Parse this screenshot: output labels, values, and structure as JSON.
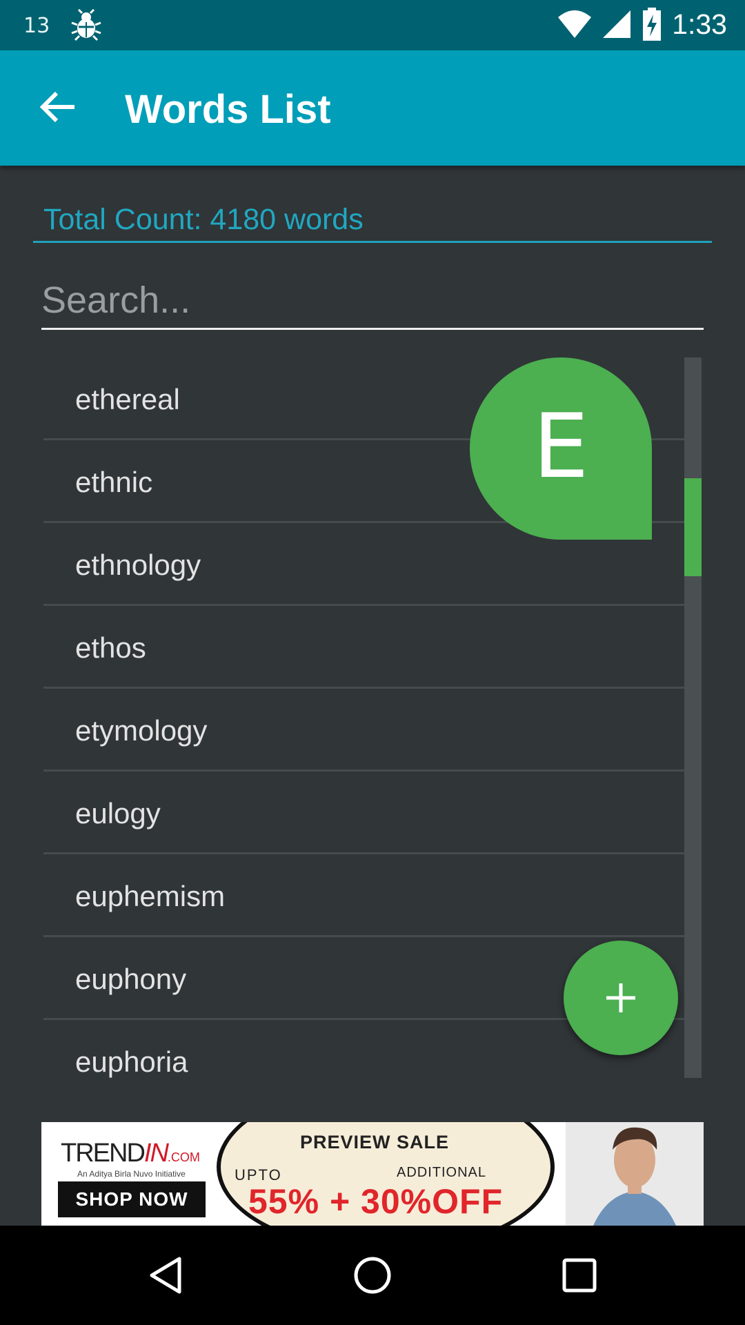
{
  "status_bar": {
    "notification_count": "13",
    "time": "1:33",
    "icons": [
      "bug-icon",
      "wifi-icon",
      "signal-icon",
      "battery-charging-icon"
    ]
  },
  "app_bar": {
    "title": "Words List",
    "back_icon": "arrow-back-icon"
  },
  "total_count_label": "Total Count: 4180 words",
  "search": {
    "placeholder": "Search...",
    "value": ""
  },
  "words": [
    "ethereal",
    "ethnic",
    "ethnology",
    "ethos",
    "etymology",
    "eulogy",
    "euphemism",
    "euphony",
    "euphoria"
  ],
  "fast_scroll_letter": "E",
  "fab": {
    "icon": "plus-icon"
  },
  "ad": {
    "brand": "TREND",
    "brand_accent": "IN",
    "brand_suffix": ".COM",
    "tagline": "An Aditya Birla Nuvo Initiative",
    "cta": "SHOP NOW",
    "headline": "PREVIEW SALE",
    "upto": "UPTO",
    "additional": "ADDITIONAL",
    "offer": "55% + 30%OFF"
  },
  "nav_bar": {
    "icons": [
      "back-triangle-icon",
      "home-circle-icon",
      "recents-square-icon"
    ]
  },
  "colors": {
    "status_bar": "#006270",
    "app_bar": "#009eb8",
    "background": "#303538",
    "accent": "#4caf50",
    "count_text": "#20a8c1"
  }
}
